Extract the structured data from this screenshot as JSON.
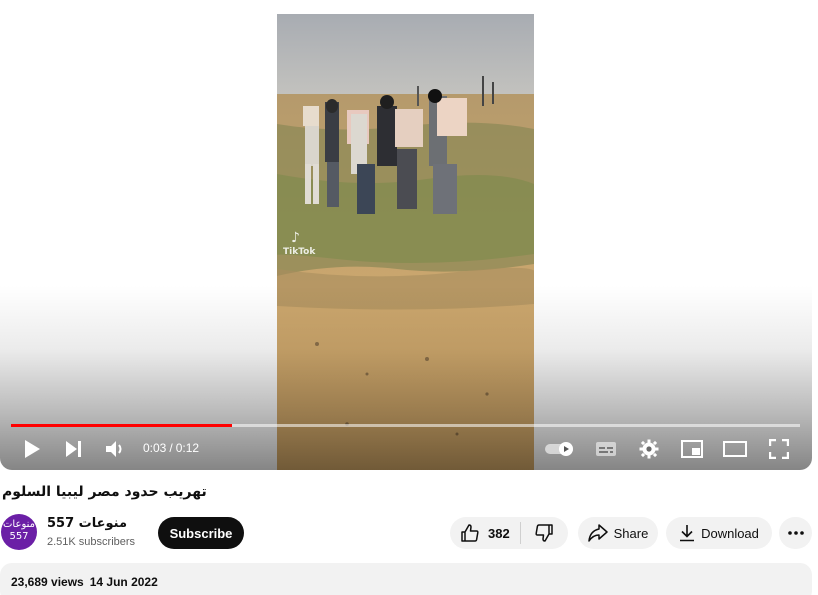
{
  "video": {
    "watermark": "TikTok",
    "progress": 0.28
  },
  "player": {
    "current_time": "0:03",
    "separator": "/",
    "duration": "0:12"
  },
  "video_title": "تهريب حدود مصر ليبيا السلوم",
  "channel": {
    "avatar_text": "منوعات 557",
    "name": "557 منوعات",
    "subscribers": "2.51K subscribers",
    "subscribe_label": "Subscribe"
  },
  "actions": {
    "likes": "382",
    "share_label": "Share",
    "download_label": "Download"
  },
  "description": {
    "views": "23,689 views",
    "date": "14 Jun 2022"
  },
  "colors": {
    "progress": "#ff0000",
    "subscribe_bg": "#0f0f0f",
    "pill_bg": "#f2f2f2",
    "avatar_bg": "#6b1fa6"
  },
  "icons": {
    "play": "play-icon",
    "next": "next-icon",
    "volume": "volume-icon",
    "autoplay": "autoplay-toggle-icon",
    "captions": "captions-icon",
    "settings": "gear-icon",
    "miniplayer": "miniplayer-icon",
    "theater": "theater-mode-icon",
    "fullscreen": "fullscreen-icon",
    "like": "thumbs-up-icon",
    "dislike": "thumbs-down-icon",
    "share": "share-icon",
    "download": "download-icon",
    "more": "more-actions-icon"
  }
}
